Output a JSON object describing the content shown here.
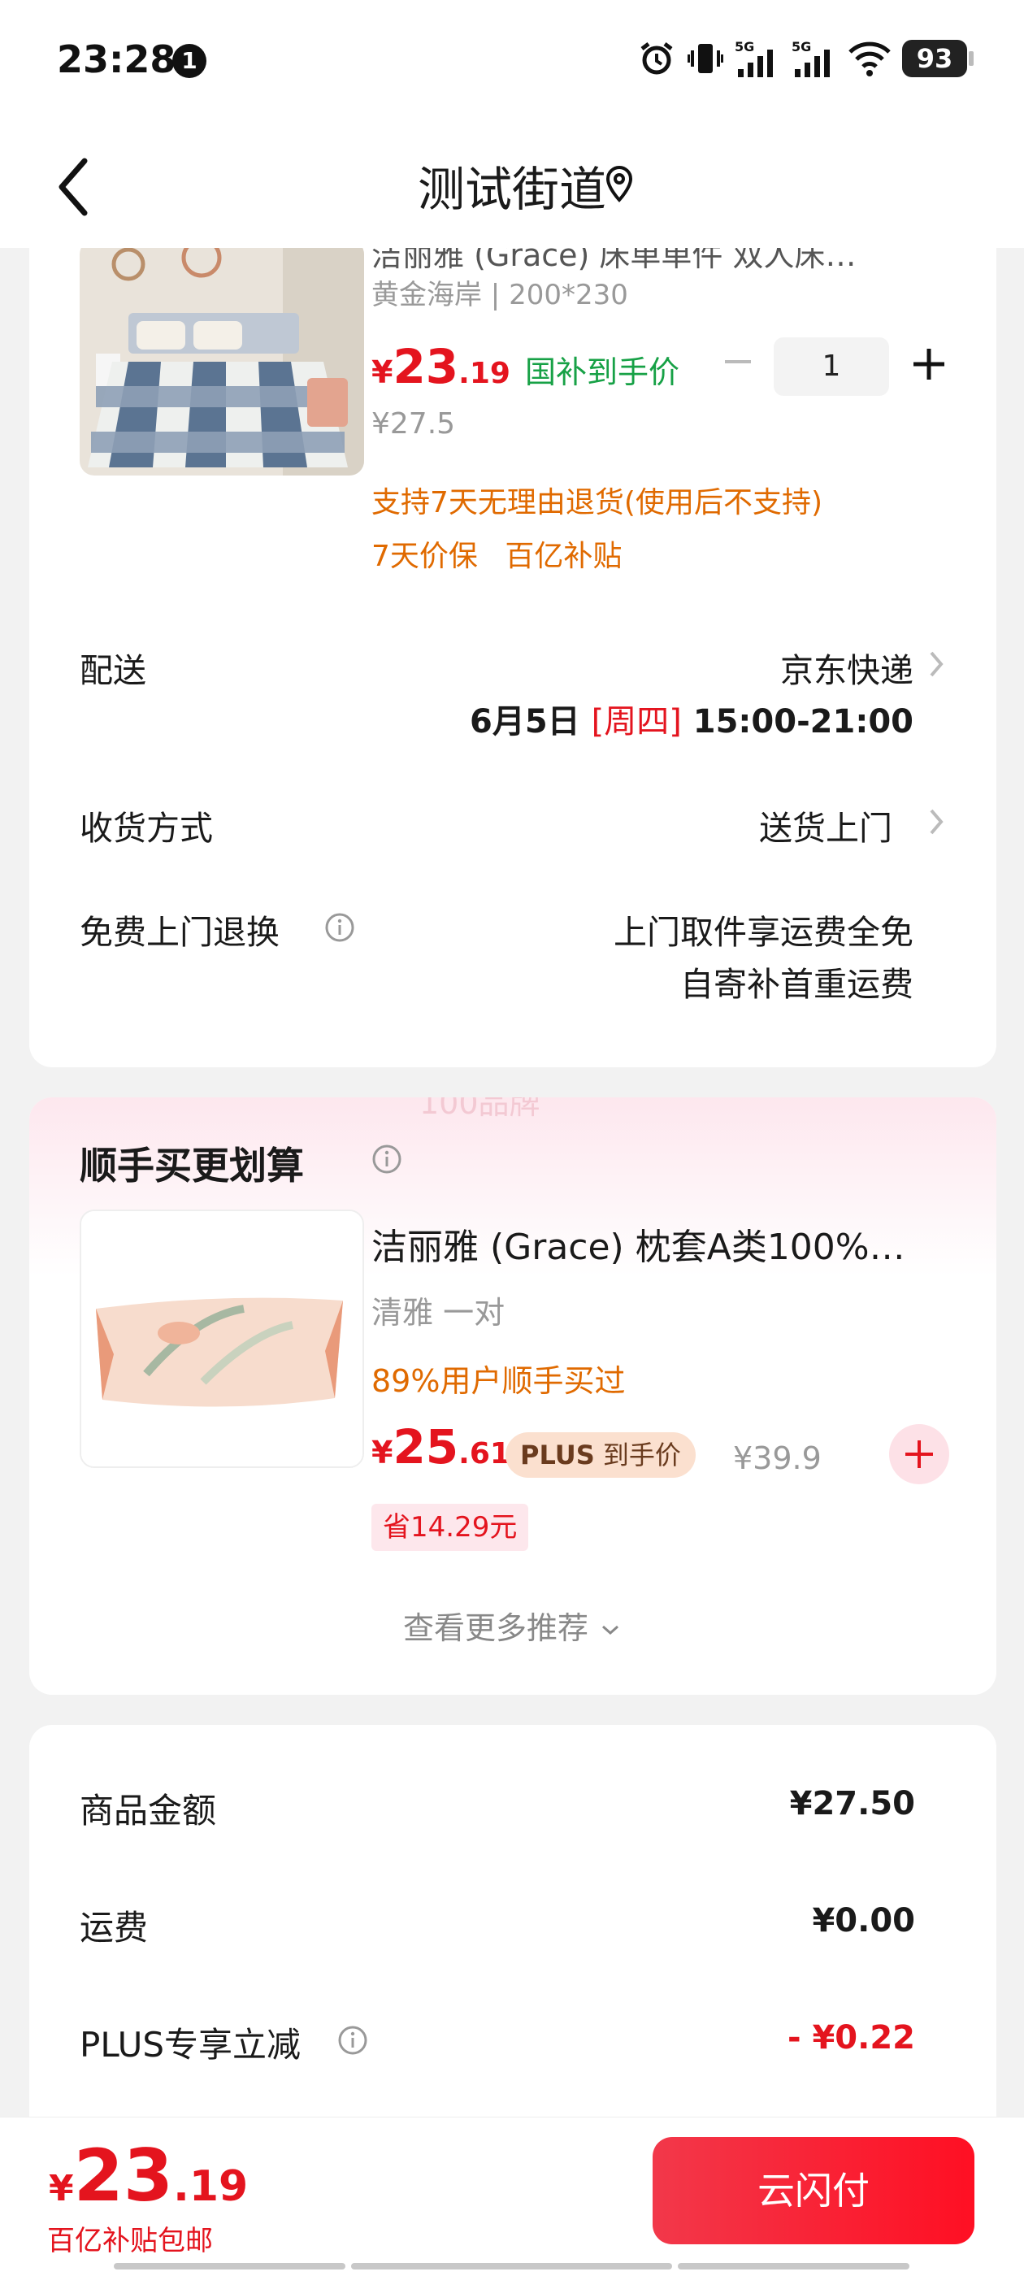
{
  "status_bar": {
    "time": "23:28",
    "notification_count": "1",
    "battery": "93"
  },
  "header": {
    "title": "测试街道"
  },
  "product": {
    "title": "洁丽雅 (Grace) 床单单件 双人床…",
    "spec": "黄金海岸 | 200*230",
    "price_yen": "¥",
    "price_int": "23",
    "price_dec": ".19",
    "price_tag": "国补到手价",
    "quantity": "1",
    "original_price": "¥27.5",
    "policy_return": "支持7天无理由退货(使用后不支持)",
    "policy_tags": [
      "7天价保",
      "百亿补贴"
    ]
  },
  "delivery": {
    "label": "配送",
    "carrier": "京东快递",
    "date": "6月5日",
    "weekday": "[周四]",
    "time_window": "15:00-21:00"
  },
  "receive_method": {
    "label": "收货方式",
    "value": "送货上门"
  },
  "free_return": {
    "label": "免费上门退换",
    "line1": "上门取件享运费全免",
    "line2": "自寄补首重运费"
  },
  "recommend": {
    "watermark": "100品牌",
    "section_title": "顺手买更划算",
    "item_title": "洁丽雅 (Grace) 枕套A类100%…",
    "item_spec": "清雅 一对",
    "item_buyers": "89%用户顺手买过",
    "price_yen": "¥",
    "price_int": "25",
    "price_dec": ".61",
    "plus_label": "PLUS",
    "plus_text": "到手价",
    "original_price": "¥39.9",
    "saving": "省14.29元",
    "more_link": "查看更多推荐"
  },
  "summary": {
    "goods_label": "商品金额",
    "goods_value": "¥27.50",
    "shipping_label": "运费",
    "shipping_value": "¥0.00",
    "plus_label": "PLUS专享立减",
    "plus_value": "- ¥0.22"
  },
  "footer": {
    "price_yen": "¥",
    "price_int": "23",
    "price_dec": ".19",
    "subtitle": "百亿补贴包邮",
    "pay_label": "云闪付"
  },
  "colors": {
    "accent_red": "#e4141e",
    "subsidy_green": "#17a146",
    "policy_orange": "#e06a00"
  }
}
